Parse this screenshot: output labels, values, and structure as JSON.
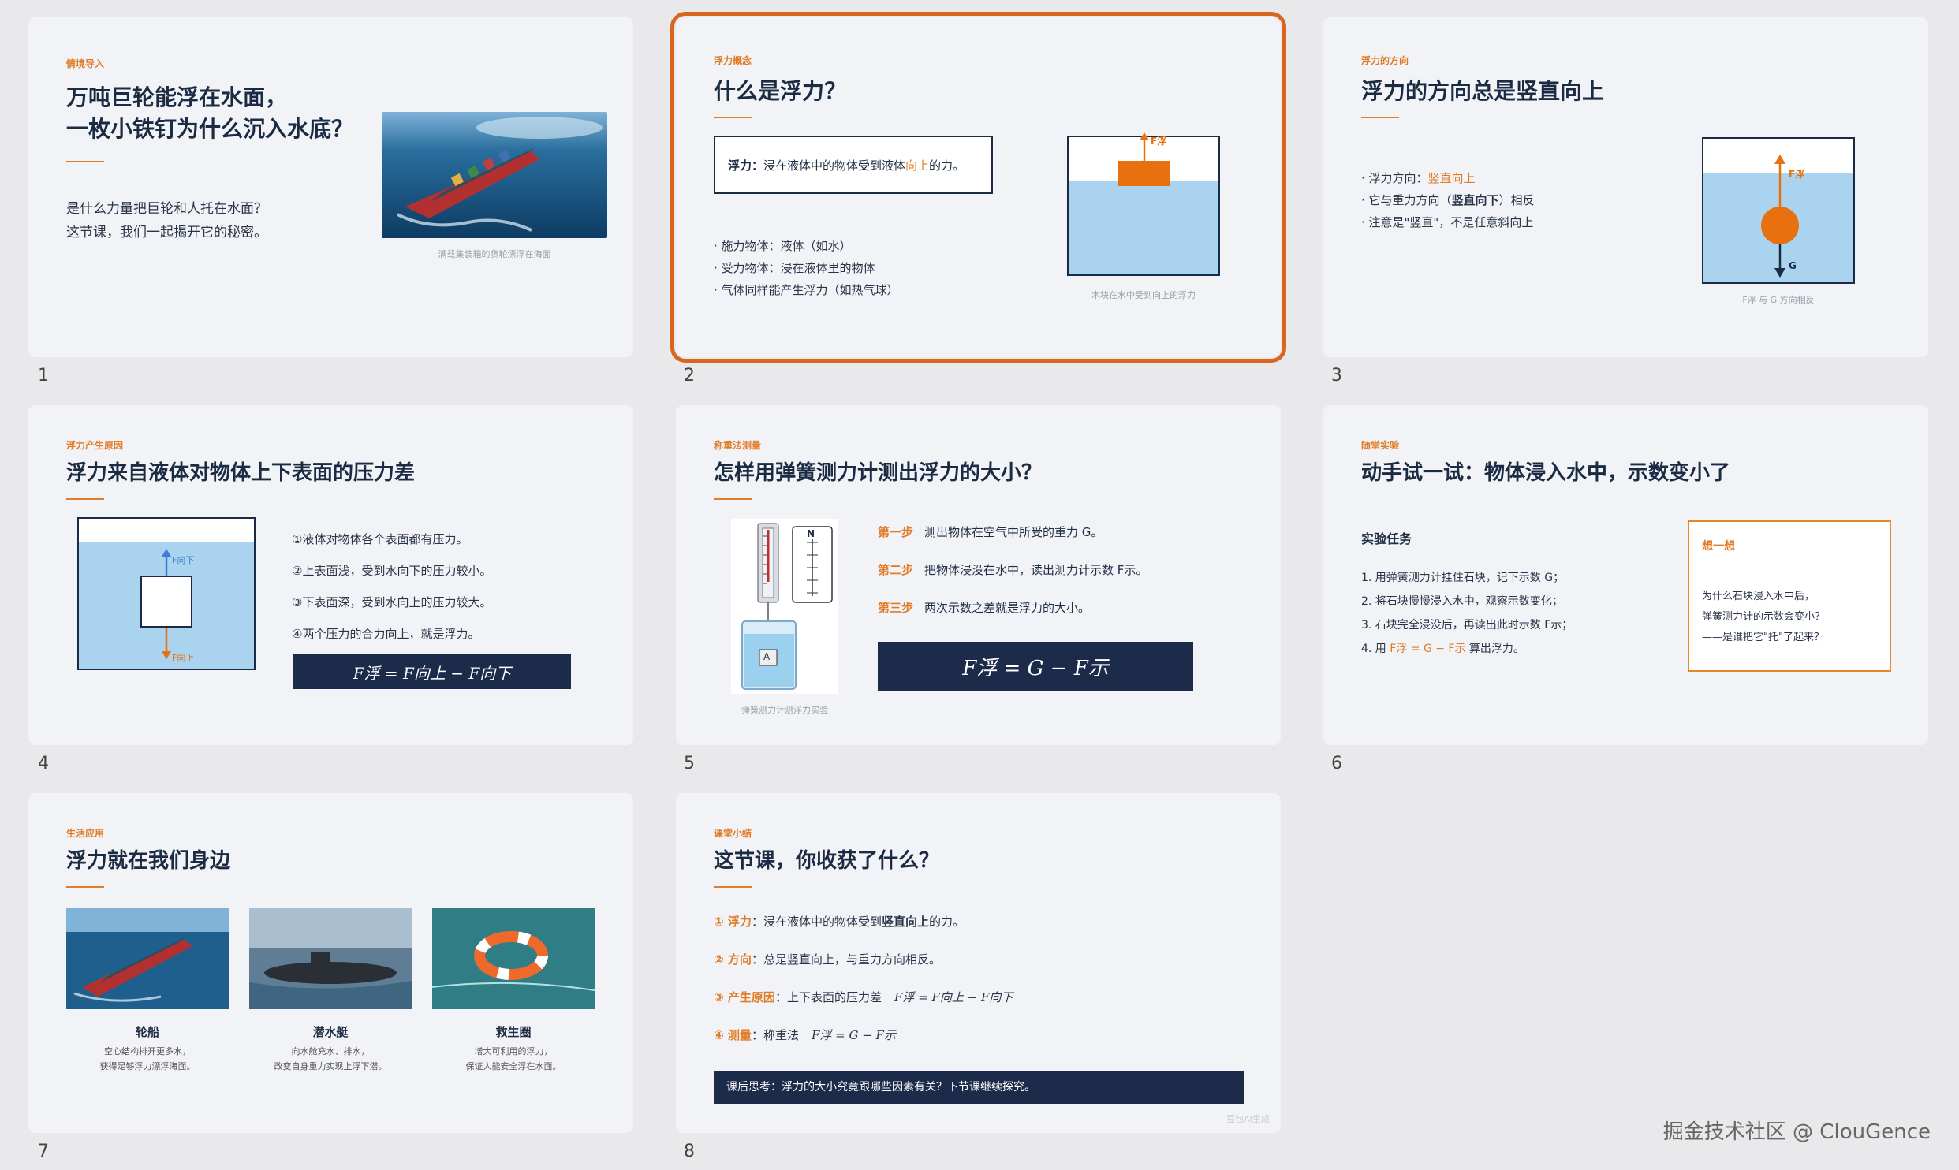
{
  "slides": [
    {
      "num": "1",
      "tag": "情境导入",
      "title1": "万吨巨轮能浮在水面，",
      "title2": "一枚小铁钉为什么沉入水底？",
      "body1": "是什么力量把巨轮和人托在水面？",
      "body2": "这节课，我们一起揭开它的秘密。",
      "caption": "满载集装箱的货轮漂浮在海面"
    },
    {
      "num": "2",
      "tag": "浮力概念",
      "title": "什么是浮力？",
      "def_label": "浮力：",
      "def_text1": "浸在液体中的物体受到液体",
      "def_highlight": "向上",
      "def_text2": "的力。",
      "bullets": [
        "· 施力物体：液体（如水）",
        "· 受力物体：浸在液体里的物体",
        "· 气体同样能产生浮力（如热气球）"
      ],
      "arrow_label": "F浮",
      "caption": "木块在水中受到向上的浮力"
    },
    {
      "num": "3",
      "tag": "浮力的方向",
      "title": "浮力的方向总是竖直向上",
      "b1a": "· 浮力方向：",
      "b1b": "竖直向上",
      "b2a": "· 它与重力方向（",
      "b2b": "竖直向下",
      "b2c": "）相反",
      "b3": "· 注意是\"竖直\"，不是任意斜向上",
      "up_label": "F浮",
      "down_label": "G",
      "caption": "F浮 与 G 方向相反"
    },
    {
      "num": "4",
      "tag": "浮力产生原因",
      "title": "浮力来自液体对物体上下表面的压力差",
      "items": [
        "①液体对物体各个表面都有压力。",
        "②上表面浅，受到水向下的压力较小。",
        "③下表面深，受到水向上的压力较大。",
        "④两个压力的合力向上，就是浮力。"
      ],
      "down_label": "F向下",
      "up_label": "F向上",
      "formula": "F浮 = F向上 − F向下"
    },
    {
      "num": "5",
      "tag": "称重法测量",
      "title": "怎样用弹簧测力计测出浮力的大小？",
      "steps": [
        {
          "label": "第一步",
          "text": "测出物体在空气中所受的重力 G。"
        },
        {
          "label": "第二步",
          "text": "把物体浸没在水中，读出测力计示数 F示。"
        },
        {
          "label": "第三步",
          "text": "两次示数之差就是浮力的大小。"
        }
      ],
      "formula": "F浮 = G − F示",
      "caption": "弹簧测力计测浮力实验",
      "scale_unit": "N",
      "block_label": "A"
    },
    {
      "num": "6",
      "tag": "随堂实验",
      "title": "动手试一试：物体浸入水中，示数变小了",
      "task_title": "实验任务",
      "tasks": [
        "1. 用弹簧测力计挂住石块，记下示数 G；",
        "2. 将石块慢慢浸入水中，观察示数变化；",
        "3. 石块完全浸没后，再读出此时示数 F示；"
      ],
      "task4a": "4. 用 ",
      "task4b": "F浮 = G − F示",
      "task4c": " 算出浮力。",
      "think_title": "想一想",
      "think_lines": [
        "为什么石块浸入水中后，",
        "弹簧测力计的示数会变小？",
        "——是谁把它\"托\"了起来？"
      ]
    },
    {
      "num": "7",
      "tag": "生活应用",
      "title": "浮力就在我们身边",
      "cards": [
        {
          "name": "轮船",
          "l1": "空心结构排开更多水，",
          "l2": "获得足够浮力漂浮海面。"
        },
        {
          "name": "潜水艇",
          "l1": "向水舱充水、排水，",
          "l2": "改变自身重力实现上浮下潜。"
        },
        {
          "name": "救生圈",
          "l1": "增大可利用的浮力，",
          "l2": "保证人能安全浮在水面。"
        }
      ]
    },
    {
      "num": "8",
      "tag": "课堂小结",
      "title": "这节课，你收获了什么？",
      "s1a": "① 浮力",
      "s1b": "：浸在液体中的物体受到",
      "s1c": "竖直向上",
      "s1d": "的力。",
      "s2a": "② 方向",
      "s2b": "：总是竖直向上，与重力方向相反。",
      "s3a": "③ 产生原因",
      "s3b": "：上下表面的压力差",
      "s3f": "F浮 = F向上 − F向下",
      "s4a": "④ 测量",
      "s4b": "：称重法",
      "s4f": "F浮 = G − F示",
      "footer": "课后思考：浮力的大小究竟跟哪些因素有关？下节课继续探究。",
      "ai_mark": "豆包AI生成"
    }
  ],
  "watermark": "掘金技术社区 @ ClouGence"
}
